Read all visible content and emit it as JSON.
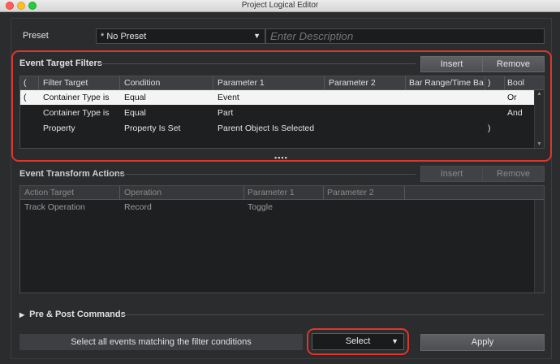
{
  "window": {
    "title": "Project Logical Editor"
  },
  "preset": {
    "label": "Preset",
    "value": "* No Preset",
    "description_placeholder": "Enter Description"
  },
  "filters": {
    "heading": "Event Target Filters",
    "insert_label": "Insert",
    "remove_label": "Remove",
    "columns": [
      "(",
      "Filter Target",
      "Condition",
      "Parameter 1",
      "Parameter 2",
      "Bar Range/Time Bas",
      ")",
      "Bool"
    ],
    "rows": [
      [
        "(",
        "Container Type is",
        "Equal",
        "Event",
        "",
        "",
        "",
        "Or"
      ],
      [
        "",
        "Container Type is",
        "Equal",
        "Part",
        "",
        "",
        "",
        "And"
      ],
      [
        "",
        "Property",
        "Property Is Set",
        "Parent Object Is Selected",
        "",
        "",
        ")",
        ""
      ]
    ],
    "selected_row": 0,
    "splitter": "▪▪▪▪"
  },
  "actions": {
    "heading": "Event Transform Actions",
    "insert_label": "Insert",
    "remove_label": "Remove",
    "columns": [
      "Action Target",
      "Operation",
      "Parameter 1",
      "Parameter 2"
    ],
    "rows": [
      [
        "Track Operation",
        "Record",
        "Toggle",
        ""
      ]
    ]
  },
  "pre_post": {
    "label": "Pre & Post Commands"
  },
  "footer": {
    "info": "Select all events matching the filter conditions",
    "function_value": "Select",
    "apply_label": "Apply"
  },
  "colors": {
    "highlight": "#e0352b",
    "selected_row": "#f4f4f4"
  }
}
